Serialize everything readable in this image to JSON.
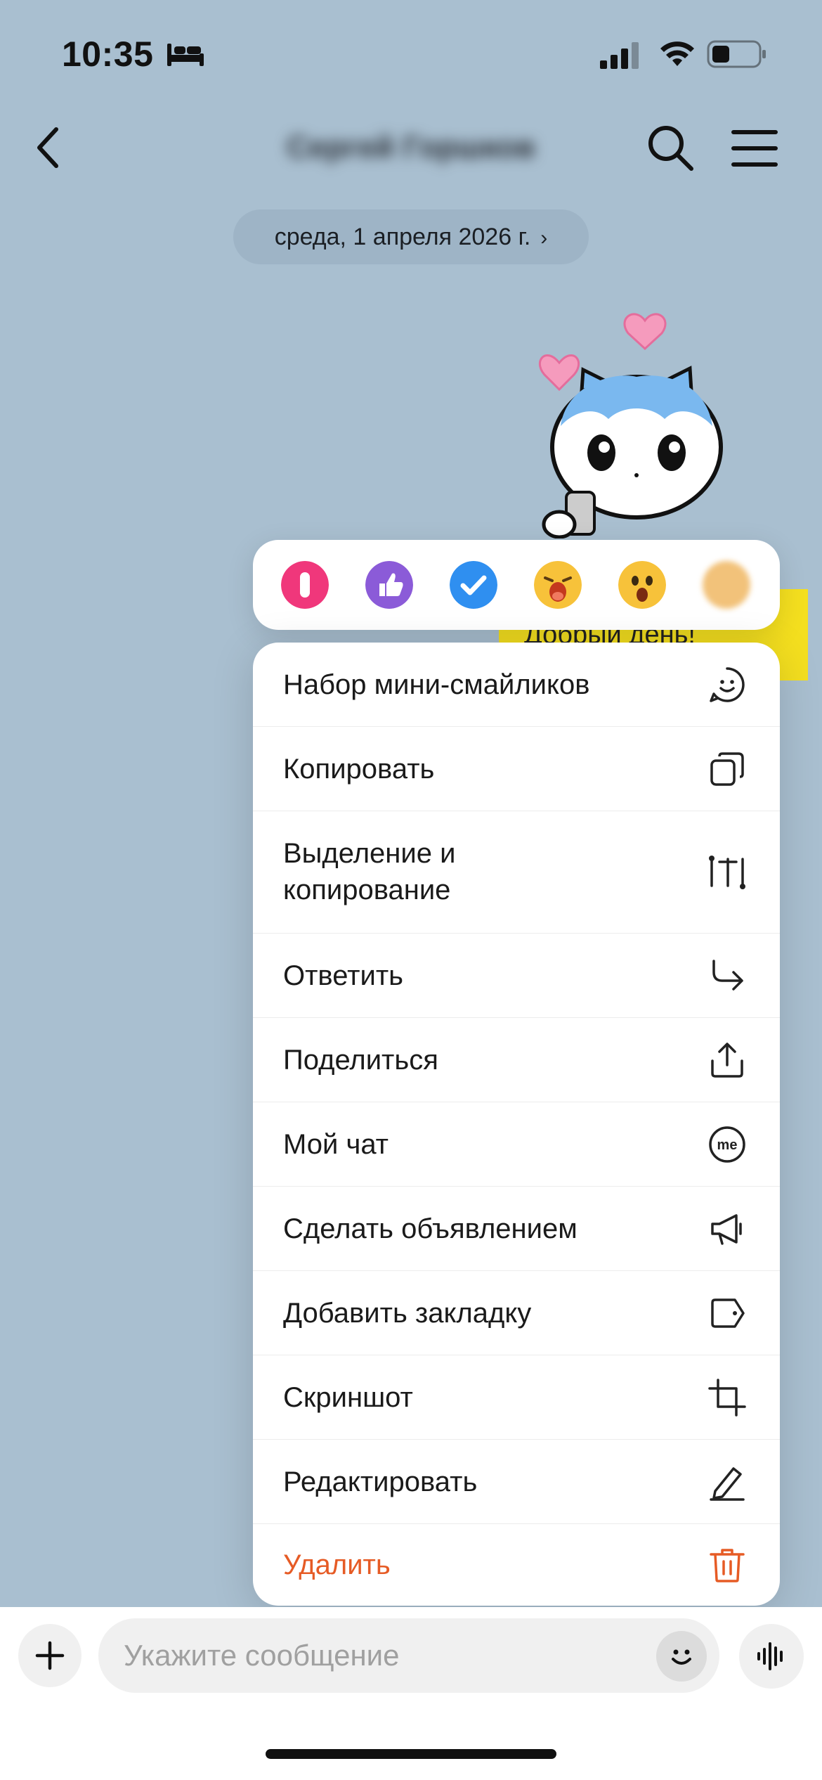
{
  "status_bar": {
    "time": "10:35",
    "icons": [
      "bed-icon",
      "signal-icon",
      "wifi-icon",
      "battery-icon"
    ]
  },
  "header": {
    "title": "Сергей Горшков",
    "icons": [
      "back-icon",
      "search-icon",
      "hamburger-menu-icon"
    ]
  },
  "date_pill": {
    "label": "среда, 1 апреля 2026 г.",
    "chevron": "›"
  },
  "message": {
    "text": "Добрый день!"
  },
  "reactions": [
    {
      "name": "heart-reaction",
      "color": "#f0377b"
    },
    {
      "name": "thumbs-up-reaction",
      "color": "#8b5bd8"
    },
    {
      "name": "check-reaction",
      "color": "#2f8ff0"
    },
    {
      "name": "laugh-reaction",
      "color": "#f7c23a"
    },
    {
      "name": "surprised-reaction",
      "color": "#f7c23a"
    },
    {
      "name": "blurred-reaction",
      "color": "#f2c27a"
    }
  ],
  "menu": {
    "items": [
      {
        "label": "Набор мини-смайликов",
        "icon": "smiley-icon"
      },
      {
        "label": "Копировать",
        "icon": "copy-icon"
      },
      {
        "label": "Выделение и\nкопирование",
        "icon": "text-select-icon"
      },
      {
        "label": "Ответить",
        "icon": "reply-icon"
      },
      {
        "label": "Поделиться",
        "icon": "share-icon"
      },
      {
        "label": "Мой чат",
        "icon": "me-icon"
      },
      {
        "label": "Сделать объявлением",
        "icon": "megaphone-icon"
      },
      {
        "label": "Добавить закладку",
        "icon": "bookmark-tag-icon"
      },
      {
        "label": "Скриншот",
        "icon": "crop-icon"
      },
      {
        "label": "Редактировать",
        "icon": "pencil-icon"
      },
      {
        "label": "Удалить",
        "icon": "trash-icon",
        "danger": true
      }
    ]
  },
  "composer": {
    "placeholder": "Укажите сообщение",
    "icons": [
      "plus-icon",
      "emoji-icon",
      "voice-icon"
    ]
  },
  "colors": {
    "background": "#a9bfd0",
    "danger": "#e65b25",
    "bubble": "#f4df1f"
  }
}
